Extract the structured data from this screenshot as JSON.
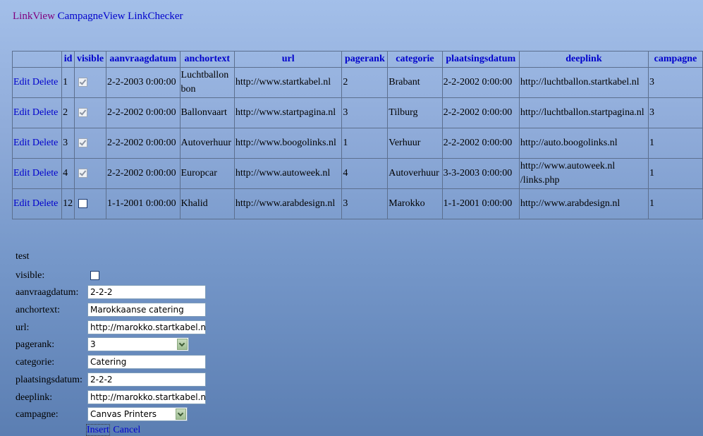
{
  "nav": {
    "links": [
      "LinkView",
      "CampagneView",
      "LinkChecker"
    ]
  },
  "grid": {
    "columns": [
      "",
      "id",
      "visible",
      "aanvraagdatum",
      "anchortext",
      "url",
      "pagerank",
      "categorie",
      "plaatsingsdatum",
      "deeplink",
      "campagne"
    ],
    "edit_label": "Edit",
    "delete_label": "Delete",
    "rows": [
      {
        "id": "1",
        "visible": true,
        "aanvraagdatum": "2-2-2003 0:00:00",
        "anchortext": "Luchtballon bon",
        "url": "http://www.startkabel.nl",
        "pagerank": "2",
        "categorie": "Brabant",
        "plaatsingsdatum": "2-2-2002 0:00:00",
        "deeplink": "http://luchtballon.startkabel.nl",
        "campagne": "3"
      },
      {
        "id": "2",
        "visible": true,
        "aanvraagdatum": "2-2-2002 0:00:00",
        "anchortext": "Ballonvaart",
        "url": "http://www.startpagina.nl",
        "pagerank": "3",
        "categorie": "Tilburg",
        "plaatsingsdatum": "2-2-2002 0:00:00",
        "deeplink": "http://luchtballon.startpagina.nl",
        "campagne": "3"
      },
      {
        "id": "3",
        "visible": true,
        "aanvraagdatum": "2-2-2002 0:00:00",
        "anchortext": "Autoverhuur",
        "url": "http://www.boogolinks.nl",
        "pagerank": "1",
        "categorie": "Verhuur",
        "plaatsingsdatum": "2-2-2002 0:00:00",
        "deeplink": "http://auto.boogolinks.nl",
        "campagne": "1"
      },
      {
        "id": "4",
        "visible": true,
        "aanvraagdatum": "2-2-2002 0:00:00",
        "anchortext": "Europcar",
        "url": "http://www.autoweek.nl",
        "pagerank": "4",
        "categorie": "Autoverhuur",
        "plaatsingsdatum": "3-3-2003 0:00:00",
        "deeplink": "http://www.autoweek.nl /links.php",
        "campagne": "1"
      },
      {
        "id": "12",
        "visible": false,
        "aanvraagdatum": "1-1-2001 0:00:00",
        "anchortext": "Khalid",
        "url": "http://www.arabdesign.nl",
        "pagerank": "3",
        "categorie": "Marokko",
        "plaatsingsdatum": "1-1-2001 0:00:00",
        "deeplink": "http://www.arabdesign.nl",
        "campagne": "1"
      }
    ]
  },
  "form": {
    "title": "test",
    "fields": {
      "visible": {
        "label": "visible:",
        "checked": false
      },
      "aanvraagdatum": {
        "label": "aanvraagdatum:",
        "value": "2-2-2"
      },
      "anchortext": {
        "label": "anchortext:",
        "value": "Marokkaanse catering"
      },
      "url": {
        "label": "url:",
        "value": "http://marokko.startkabel.nl"
      },
      "pagerank": {
        "label": "pagerank:",
        "value": "3"
      },
      "categorie": {
        "label": "categorie:",
        "value": "Catering"
      },
      "plaatsingsdatum": {
        "label": "plaatsingsdatum:",
        "value": "2-2-2"
      },
      "deeplink": {
        "label": "deeplink:",
        "value": "http://marokko.startkabel.nl"
      },
      "campagne": {
        "label": "campagne:",
        "value": "Canvas Printers"
      }
    },
    "insert_label": "Insert",
    "cancel_label": "Cancel"
  },
  "colors": {
    "link": "#0000cc",
    "visited_link": "#800080",
    "background_top": "#a3bfe9",
    "background_bottom": "#5b7eb2"
  },
  "icons": {
    "dropdown": "chevron-down-icon",
    "checkbox": "checkbox-icon"
  }
}
